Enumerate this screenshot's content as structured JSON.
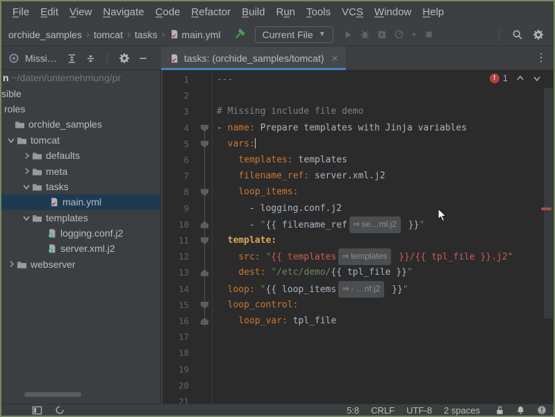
{
  "menu": {
    "items": [
      {
        "label": "File",
        "underline": 0
      },
      {
        "label": "Edit",
        "underline": 0
      },
      {
        "label": "View",
        "underline": 0
      },
      {
        "label": "Navigate",
        "underline": 0
      },
      {
        "label": "Code",
        "underline": 0
      },
      {
        "label": "Refactor",
        "underline": 0
      },
      {
        "label": "Build",
        "underline": 0
      },
      {
        "label": "Run",
        "underline": 1
      },
      {
        "label": "Tools",
        "underline": 0
      },
      {
        "label": "VCS",
        "underline": 2
      },
      {
        "label": "Window",
        "underline": 0
      },
      {
        "label": "Help",
        "underline": 0
      }
    ]
  },
  "navbar": {
    "breadcrumbs": [
      {
        "label": "orchide_samples"
      },
      {
        "label": "tomcat"
      },
      {
        "label": "tasks"
      },
      {
        "label": "main.yml",
        "icon": "yaml-file"
      }
    ],
    "run_config_label": "Current File"
  },
  "toolwindow_header": {
    "title": "Missi…"
  },
  "tabbar": {
    "active_tab": "tasks: (orchide_samples/tomcat)"
  },
  "project_tree": {
    "items": [
      {
        "style": "root",
        "prefix": "n",
        "label": " ~/daten/unternehmung/pr",
        "pad": 2
      },
      {
        "label": "sible",
        "pad": 0
      },
      {
        "label": "roles",
        "pad": 4
      },
      {
        "icon": "folder",
        "label": "orchide_samples",
        "pad": 19
      },
      {
        "chevron": "down",
        "icon": "folder",
        "label": "tomcat",
        "pad": 6
      },
      {
        "chevron": "right",
        "icon": "folder",
        "label": "defaults",
        "pad": 28
      },
      {
        "chevron": "right",
        "icon": "folder",
        "label": "meta",
        "pad": 28
      },
      {
        "chevron": "down",
        "icon": "folder",
        "label": "tasks",
        "pad": 28
      },
      {
        "icon": "yaml-file",
        "label": "main.yml",
        "pad": 69,
        "selected": true
      },
      {
        "chevron": "down",
        "icon": "folder",
        "label": "templates",
        "pad": 28
      },
      {
        "icon": "jinja-file",
        "label": "logging.conf.j2",
        "pad": 66
      },
      {
        "icon": "jinja-file",
        "label": "server.xml.j2",
        "pad": 66
      },
      {
        "chevron": "right",
        "icon": "folder",
        "label": "webserver",
        "pad": 6
      }
    ]
  },
  "editor": {
    "error_count": "1",
    "chip_arrow": "⇒",
    "lines": [
      {
        "num": "1",
        "segs": [
          {
            "c": "cm",
            "t": "---"
          }
        ]
      },
      {
        "num": "2",
        "segs": []
      },
      {
        "num": "3",
        "segs": [
          {
            "c": "cm",
            "t": "# Missing include file demo"
          }
        ]
      },
      {
        "num": "4",
        "fold": "down",
        "segs": [
          {
            "c": "tx",
            "t": "- "
          },
          {
            "c": "k",
            "t": "name:"
          },
          {
            "c": "tx",
            "t": " Prepare templates with Jinja variables"
          }
        ]
      },
      {
        "num": "5",
        "fold": "down",
        "segs": [
          {
            "c": "tx",
            "t": "  "
          },
          {
            "c": "k",
            "t": "vars:"
          },
          {
            "caret": true
          }
        ]
      },
      {
        "num": "6",
        "segs": [
          {
            "c": "tx",
            "t": "    "
          },
          {
            "c": "k",
            "t": "templates:"
          },
          {
            "c": "tx",
            "t": " templates"
          }
        ]
      },
      {
        "num": "7",
        "segs": [
          {
            "c": "tx",
            "t": "    "
          },
          {
            "c": "k",
            "t": "filename_ref:"
          },
          {
            "c": "tx",
            "t": " server.xml.j2"
          }
        ]
      },
      {
        "num": "8",
        "fold": "down",
        "segs": [
          {
            "c": "tx",
            "t": "    "
          },
          {
            "c": "k",
            "t": "loop_items:"
          }
        ]
      },
      {
        "num": "9",
        "segs": [
          {
            "c": "tx",
            "t": "      - logging.conf.j2"
          }
        ]
      },
      {
        "num": "10",
        "fold": "up",
        "segs": [
          {
            "c": "tx",
            "t": "      - "
          },
          {
            "c": "s",
            "t": "\""
          },
          {
            "c": "tx",
            "t": "{{ filename_ref"
          },
          {
            "chip": "se…ml.j2"
          },
          {
            "c": "tx",
            "t": " }}"
          },
          {
            "c": "s",
            "t": "\""
          }
        ]
      },
      {
        "num": "11",
        "fold": "down",
        "segs": [
          {
            "c": "tx",
            "t": "  "
          },
          {
            "c": "kb",
            "t": "template:"
          }
        ]
      },
      {
        "num": "12",
        "segs": [
          {
            "c": "tx",
            "t": "    "
          },
          {
            "c": "k",
            "t": "src:"
          },
          {
            "c": "tx",
            "t": " "
          },
          {
            "c": "s",
            "t": "\""
          },
          {
            "c": "e",
            "t": "{{ templates"
          },
          {
            "chip": "templates"
          },
          {
            "c": "e",
            "t": " }}/{{ tpl_file }}.j2"
          },
          {
            "c": "s",
            "t": "\""
          }
        ]
      },
      {
        "num": "13",
        "fold": "up",
        "segs": [
          {
            "c": "tx",
            "t": "    "
          },
          {
            "c": "k",
            "t": "dest:"
          },
          {
            "c": "tx",
            "t": " "
          },
          {
            "c": "s",
            "t": "\"/etc/demo/"
          },
          {
            "c": "tx",
            "t": "{{ tpl_file }}"
          },
          {
            "c": "s",
            "t": "\""
          }
        ]
      },
      {
        "num": "14",
        "segs": [
          {
            "c": "tx",
            "t": "  "
          },
          {
            "c": "k",
            "t": "loop:"
          },
          {
            "c": "tx",
            "t": " "
          },
          {
            "c": "s",
            "t": "\""
          },
          {
            "c": "tx",
            "t": "{{ loop_items"
          },
          {
            "chip": "- …nf.j2"
          },
          {
            "c": "tx",
            "t": " }}"
          },
          {
            "c": "s",
            "t": "\""
          }
        ]
      },
      {
        "num": "15",
        "fold": "down",
        "segs": [
          {
            "c": "tx",
            "t": "  "
          },
          {
            "c": "k",
            "t": "loop_control:"
          }
        ]
      },
      {
        "num": "16",
        "fold": "up",
        "segs": [
          {
            "c": "tx",
            "t": "    "
          },
          {
            "c": "k",
            "t": "loop_var:"
          },
          {
            "c": "tx",
            "t": " tpl_file"
          }
        ]
      },
      {
        "num": "17",
        "segs": []
      },
      {
        "num": "18",
        "segs": []
      },
      {
        "num": "19",
        "segs": []
      },
      {
        "num": "20",
        "segs": []
      },
      {
        "num": "21",
        "segs": []
      }
    ]
  },
  "statusbar": {
    "items": [
      "5:8",
      "CRLF",
      "UTF-8",
      "2 spaces"
    ]
  },
  "colors": {
    "window_border": "#76895f",
    "panel_bg": "#3c3f41",
    "editor_bg": "#2b2b2b",
    "tab_accent": "#4682c4",
    "selection_bg": "#1d3a52",
    "key_orange": "#cc7832",
    "string_green": "#6a8759",
    "error_red": "#cf5b56",
    "comment_gray": "#808080",
    "hammer_green": "#499c54",
    "error_badge": "#b3413c"
  }
}
